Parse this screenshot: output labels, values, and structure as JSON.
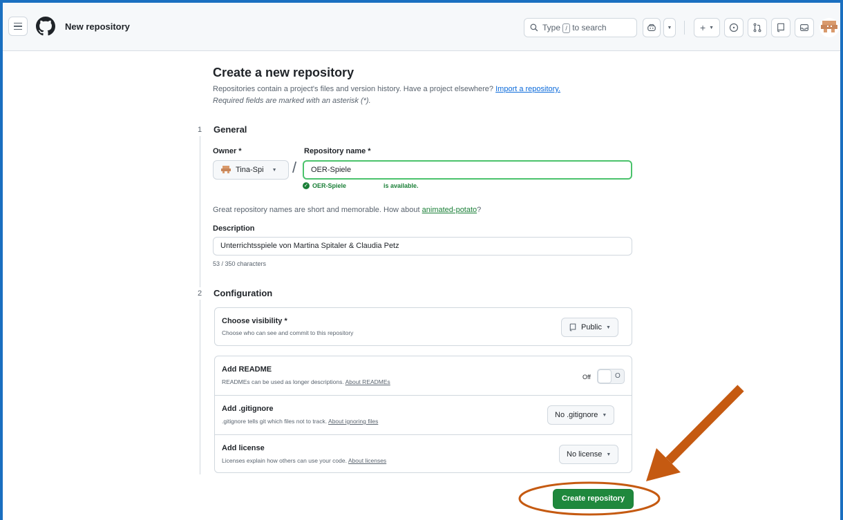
{
  "header": {
    "title": "New repository",
    "search_prefix": "Type",
    "search_key": "/",
    "search_suffix": "to search",
    "plus": "+"
  },
  "page": {
    "title": "Create a new repository",
    "subtitle": "Repositories contain a project's files and version history. Have a project elsewhere?",
    "import_link": "Import a repository.",
    "required_note": "Required fields are marked with an asterisk (*)."
  },
  "general": {
    "step": "1",
    "title": "General",
    "owner_label": "Owner *",
    "owner_value": "Tina-Spi",
    "slash": "/",
    "repo_label": "Repository name *",
    "repo_value": "OER-Spiele",
    "avail_name": "OER-Spiele",
    "avail_text": "is available.",
    "hint_text": "Great repository names are short and memorable. How about",
    "hint_suggestion": "animated-potato",
    "hint_end": "?",
    "description_label": "Description",
    "description_value": "Unterrichtsspiele von Martina Spitaler & Claudia Petz",
    "char_count": "53 / 350 characters"
  },
  "configuration": {
    "step": "2",
    "title": "Configuration",
    "visibility_title": "Choose visibility *",
    "visibility_desc": "Choose who can see and commit to this repository",
    "visibility_value": "Public",
    "readme_title": "Add README",
    "readme_desc": "READMEs can be used as longer descriptions.",
    "readme_link": "About READMEs",
    "readme_toggle_label": "Off",
    "readme_toggle_glyph": "O",
    "gitignore_title": "Add .gitignore",
    "gitignore_desc": ".gitignore tells git which files not to track.",
    "gitignore_link": "About ignoring files",
    "gitignore_value": "No .gitignore",
    "license_title": "Add license",
    "license_desc": "Licenses explain how others can use your code.",
    "license_link": "About licenses",
    "license_value": "No license"
  },
  "actions": {
    "create_label": "Create repository"
  },
  "colors": {
    "primary_green": "#1f883d",
    "link_blue": "#0969da",
    "annotation_orange": "#c55a11",
    "frame_blue": "#1a6fc0"
  }
}
